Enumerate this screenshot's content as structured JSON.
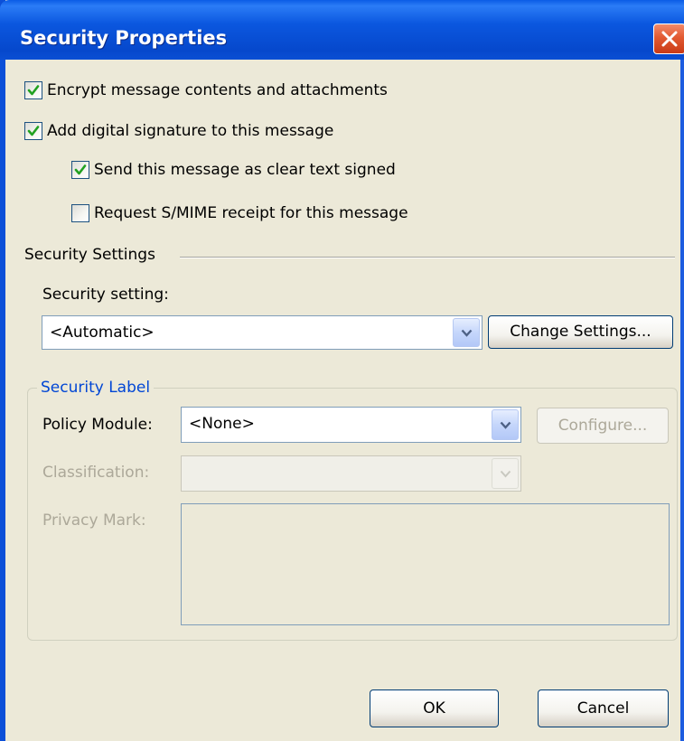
{
  "window": {
    "title": "Security Properties"
  },
  "options": {
    "encrypt": {
      "label": "Encrypt message contents and attachments",
      "checked": true
    },
    "add_signature": {
      "label": "Add digital signature to this message",
      "checked": true
    },
    "clear_text_signed": {
      "label": "Send this message as clear text signed",
      "checked": true
    },
    "smime_receipt": {
      "label": "Request S/MIME receipt for this message",
      "checked": false
    }
  },
  "security_settings": {
    "section_label": "Security Settings",
    "field_label": "Security setting:",
    "selected_value": "<Automatic>",
    "change_button": "Change Settings..."
  },
  "security_label": {
    "group_title": "Security Label",
    "policy_module_label": "Policy Module:",
    "policy_module_value": "<None>",
    "configure_button": "Configure...",
    "classification_label": "Classification:",
    "classification_value": "",
    "privacy_mark_label": "Privacy Mark:",
    "privacy_mark_value": ""
  },
  "footer": {
    "ok_label": "OK",
    "cancel_label": "Cancel"
  },
  "colors": {
    "titlebar": "#0b57df",
    "dialog_bg": "#ece9d8",
    "group_title": "#0046d5",
    "check_mark": "#21a121",
    "close_button": "#e25a32"
  }
}
